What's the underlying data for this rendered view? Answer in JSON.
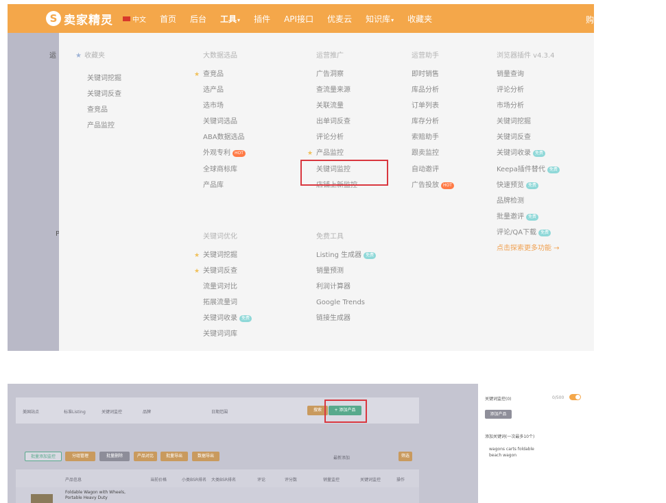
{
  "header": {
    "logo_text": "卖家精灵",
    "lang": "中文",
    "nav": [
      "首页",
      "后台",
      "工具",
      "插件",
      "API接口",
      "优麦云",
      "知识库",
      "收藏夹"
    ],
    "right_text": "购"
  },
  "left_strip": {
    "letter_top": "运",
    "letter_bottom": "P"
  },
  "menu": {
    "favorites": {
      "title": "收藏夹",
      "items": [
        "关键词挖掘",
        "关键词反查",
        "查竞品",
        "产品监控"
      ]
    },
    "big_data": {
      "title": "大数据选品",
      "items": [
        "查竞品",
        "选产品",
        "选市场",
        "关键词选品",
        "ABA数据选品",
        "外观专利",
        "全球商标库",
        "产品库"
      ],
      "hot_badge": "HOT"
    },
    "operations": {
      "title": "运营推广",
      "items": [
        "广告洞察",
        "查流量来源",
        "关联流量",
        "出单词反查",
        "评论分析",
        "产品监控",
        "关键词监控",
        "店铺上新监控"
      ]
    },
    "assistant": {
      "title": "运营助手",
      "items": [
        "即时销售",
        "库品分析",
        "订单列表",
        "库存分析",
        "索赔助手",
        "跟卖监控",
        "自动邀评",
        "广告投放"
      ]
    },
    "plugin": {
      "title": "浏览器插件 v4.3.4",
      "items": [
        "销量查询",
        "评论分析",
        "市场分析",
        "关键词挖掘",
        "关键词反查",
        "关键词收录",
        "Keepa插件替代",
        "快速预览",
        "品牌检测",
        "批量邀评",
        "评论/QA下载"
      ],
      "more": "点击探索更多功能 →"
    },
    "keyword_opt": {
      "title": "关键词优化",
      "items": [
        "关键词挖掘",
        "关键词反查",
        "流量词对比",
        "拓展流量词",
        "关键词收录",
        "关键词词库"
      ]
    },
    "free_tools": {
      "title": "免费工具",
      "items": [
        "Listing 生成器",
        "销量预测",
        "利润计算器",
        "Google Trends",
        "链接生成器"
      ]
    },
    "new_badge": "免费"
  },
  "lower": {
    "toolbar_items": [
      "美国站点",
      "标准Listing",
      "关键词监控",
      "品牌",
      "日期范围"
    ],
    "search_btn": "搜索",
    "add_btn": "+ 添加产品",
    "actions": [
      "批量添加监控",
      "分组管理",
      "批量删除",
      "产品对比",
      "批量导出",
      "数据导出"
    ],
    "sort_label": "最新添加",
    "filter_label": "筛选",
    "table_headers": [
      "产品信息",
      "当前价格",
      "小类BSR排名",
      "大类BSR排名",
      "评论",
      "评分数",
      "销量监控",
      "关键词监控",
      "操作"
    ],
    "row_title": "Foldable Wagon with Wheels, Portable Heavy Duty"
  },
  "side": {
    "label": "关键词监控(0)",
    "count": "0/500",
    "btn": "添加产品",
    "hint": "添加关键词(一次最多10个)",
    "example_line1": "wagons carts foldable",
    "example_line2": "beach wagon"
  },
  "colors": {
    "brand_orange": "#f4a74a",
    "highlight_red": "#d9363e",
    "accent_green": "#58a98c"
  }
}
